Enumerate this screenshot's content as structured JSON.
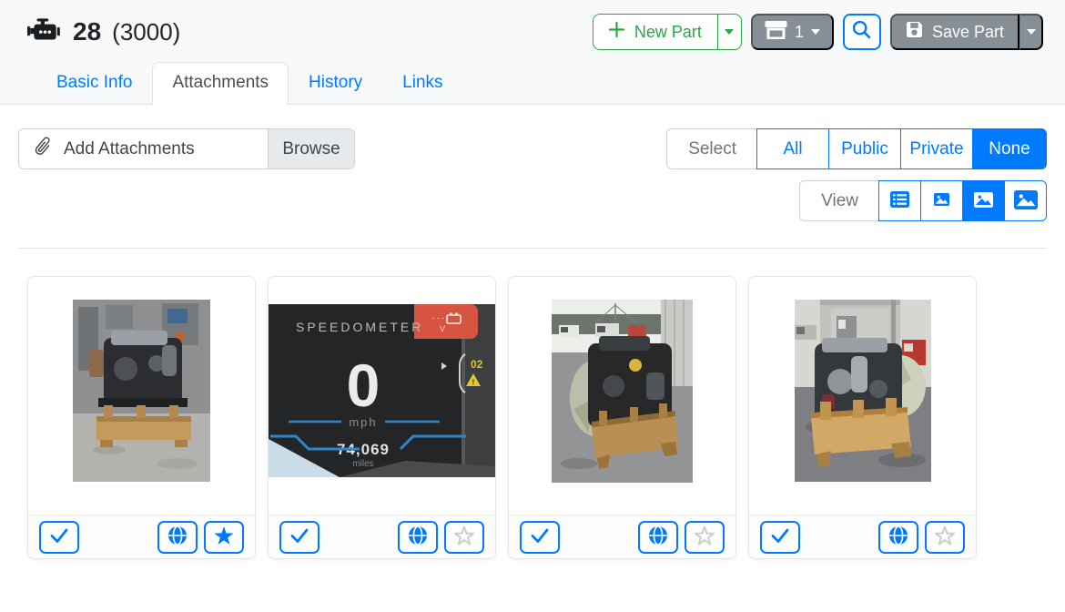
{
  "header": {
    "part_icon": "engine-icon",
    "part_number": "28",
    "part_total": "(3000)",
    "buttons": {
      "new_part_label": "New Part",
      "store_count": "1",
      "save_part_label": "Save Part"
    }
  },
  "tabs": [
    {
      "label": "Basic Info",
      "active": false
    },
    {
      "label": "Attachments",
      "active": true
    },
    {
      "label": "History",
      "active": false
    },
    {
      "label": "Links",
      "active": false
    }
  ],
  "toolbar": {
    "add_attachments_label": "Add Attachments",
    "browse_label": "Browse",
    "select_label": "Select",
    "select_options": [
      {
        "label": "All",
        "active": false
      },
      {
        "label": "Public",
        "active": false
      },
      {
        "label": "Private",
        "active": false
      },
      {
        "label": "None",
        "active": true
      }
    ],
    "view_label": "View",
    "view_options": [
      {
        "name": "list-view",
        "active": false
      },
      {
        "name": "small-thumbnail-view",
        "active": false
      },
      {
        "name": "medium-thumbnail-view",
        "active": true
      },
      {
        "name": "large-thumbnail-view",
        "active": false
      }
    ]
  },
  "attachments": [
    {
      "description": "engine on wooden pallet in workshop",
      "checked": true,
      "public": true,
      "starred": true
    },
    {
      "description": "digital speedometer dashboard display",
      "checked": true,
      "public": true,
      "starred": false,
      "image_text": {
        "title": "SPEEDOMETER",
        "speed": "0",
        "speed_unit": "mph",
        "odometer": "74,069",
        "odometer_unit": "miles",
        "warning_code": "02"
      }
    },
    {
      "description": "engine on wooden crate in truck yard",
      "checked": true,
      "public": true,
      "starred": false
    },
    {
      "description": "engine on wooden crate outside building",
      "checked": true,
      "public": true,
      "starred": false
    }
  ],
  "colors": {
    "primary": "#007bff",
    "success": "#28a745",
    "secondary": "#868e96",
    "tab_active_text": "#495057",
    "warning_red": "#d75540",
    "warning_yellow": "#e3c431"
  }
}
